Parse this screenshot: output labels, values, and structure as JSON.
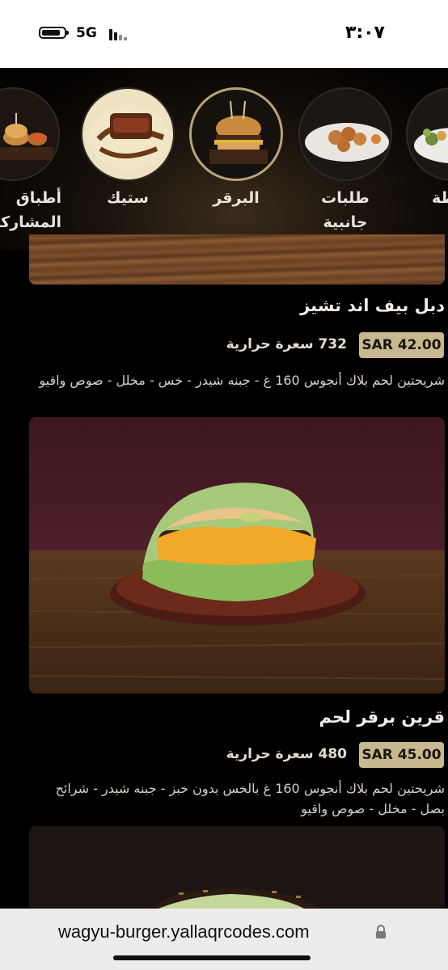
{
  "status": {
    "network": "5G",
    "time": "٣:٠٧"
  },
  "categories": [
    {
      "label": "أطباق المشاركة",
      "icon": "sharing-platter-icon"
    },
    {
      "label": "ستيك",
      "icon": "steak-icon"
    },
    {
      "label": "البرقر",
      "icon": "burger-icon",
      "active": true
    },
    {
      "label": "طلبات جانبية",
      "icon": "side-order-icon"
    },
    {
      "label": "طة",
      "icon": "salad-icon"
    }
  ],
  "items": [
    {
      "title": "دبل بيف اند تشيز",
      "price": "SAR 42.00",
      "calories": "732 سعرة حرارية",
      "description": "شريحتين لحم بلاك أنجوس 160 غ - جبنه شيدر - خس - مخلل - صوص واقيو"
    },
    {
      "title": "قرين برقر لحم",
      "price": "SAR 45.00",
      "calories": "480 سعرة حرارية",
      "description": "شريحتين لحم بلاك أنجوس 160 غ بالخس بدون خبز - جبنه شيدر - شرائح بصل - مخلل - صوص واقيو"
    }
  ],
  "browser": {
    "url": "wagyu-burger.yallaqrcodes.com"
  },
  "colors": {
    "accent": "#c7b88f",
    "background": "#000000"
  }
}
